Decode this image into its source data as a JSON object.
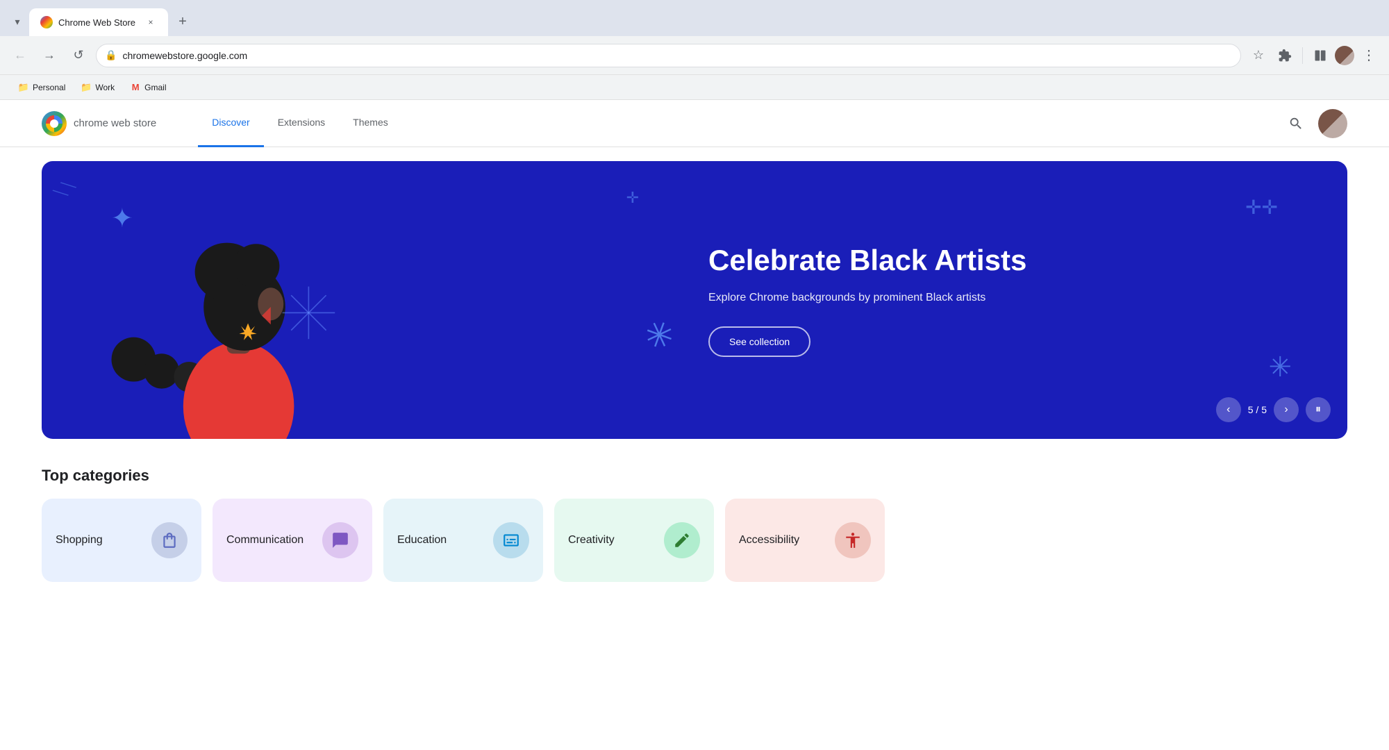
{
  "browser": {
    "tab": {
      "favicon_alt": "Chrome Web Store favicon",
      "title": "Chrome Web Store",
      "close_label": "×"
    },
    "new_tab_label": "+",
    "tab_dropdown_label": "▾",
    "toolbar": {
      "back_label": "←",
      "forward_label": "→",
      "reload_label": "↺",
      "url_icon": "⊙",
      "url": "chromewebstore.google.com",
      "bookmark_label": "☆",
      "extensions_label": "⧉",
      "profile_label": "",
      "menu_label": "⋮"
    },
    "bookmarks": [
      {
        "id": "personal",
        "icon": "📁",
        "label": "Personal"
      },
      {
        "id": "work",
        "icon": "📁",
        "label": "Work"
      },
      {
        "id": "gmail",
        "icon": "M",
        "label": "Gmail"
      }
    ]
  },
  "cws": {
    "logo_alt": "Chrome Web Store logo",
    "logo_text": "chrome web store",
    "nav": [
      {
        "id": "discover",
        "label": "Discover",
        "active": true
      },
      {
        "id": "extensions",
        "label": "Extensions",
        "active": false
      },
      {
        "id": "themes",
        "label": "Themes",
        "active": false
      }
    ],
    "search_icon": "🔍",
    "hero": {
      "title": "Celebrate Black Artists",
      "subtitle": "Explore Chrome backgrounds by prominent Black artists",
      "cta_label": "See collection",
      "slide_prev": "‹",
      "slide_next": "›",
      "slide_pause": "⏸",
      "slide_current": "5",
      "slide_total": "5"
    },
    "top_categories_title": "Top categories",
    "categories": [
      {
        "id": "shopping",
        "label": "Shopping",
        "icon": "🛍",
        "color_class": "cat-shopping"
      },
      {
        "id": "communication",
        "label": "Communication",
        "icon": "💬",
        "color_class": "cat-communication"
      },
      {
        "id": "education",
        "label": "Education",
        "icon": "✉",
        "color_class": "cat-education"
      },
      {
        "id": "creativity",
        "label": "Creativity",
        "icon": "✏",
        "color_class": "cat-creativity"
      },
      {
        "id": "accessibility",
        "label": "Accessibility",
        "icon": "♿",
        "color_class": "cat-accessibility"
      }
    ]
  }
}
